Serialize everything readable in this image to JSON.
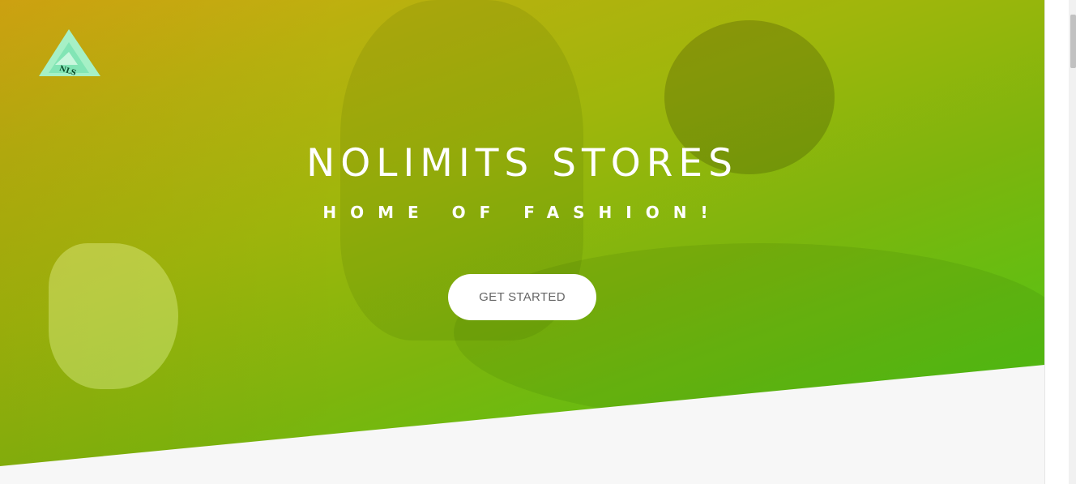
{
  "brand": {
    "logo_text": "NLS",
    "logo_icon": "triangle-mountain-logo",
    "logo_colors": {
      "outer": "#a6f0c6",
      "inner": "#7be3b1",
      "text": "#0b4a2a"
    }
  },
  "hero": {
    "title": "NOLIMITS STORES",
    "subtitle": "HOME OF FASHION!",
    "cta_label": "GET STARTED",
    "gradient_colors": [
      "#d7a912",
      "#9fb60c",
      "#48c71a"
    ]
  },
  "page": {
    "background_color": "#f7f7f7"
  }
}
